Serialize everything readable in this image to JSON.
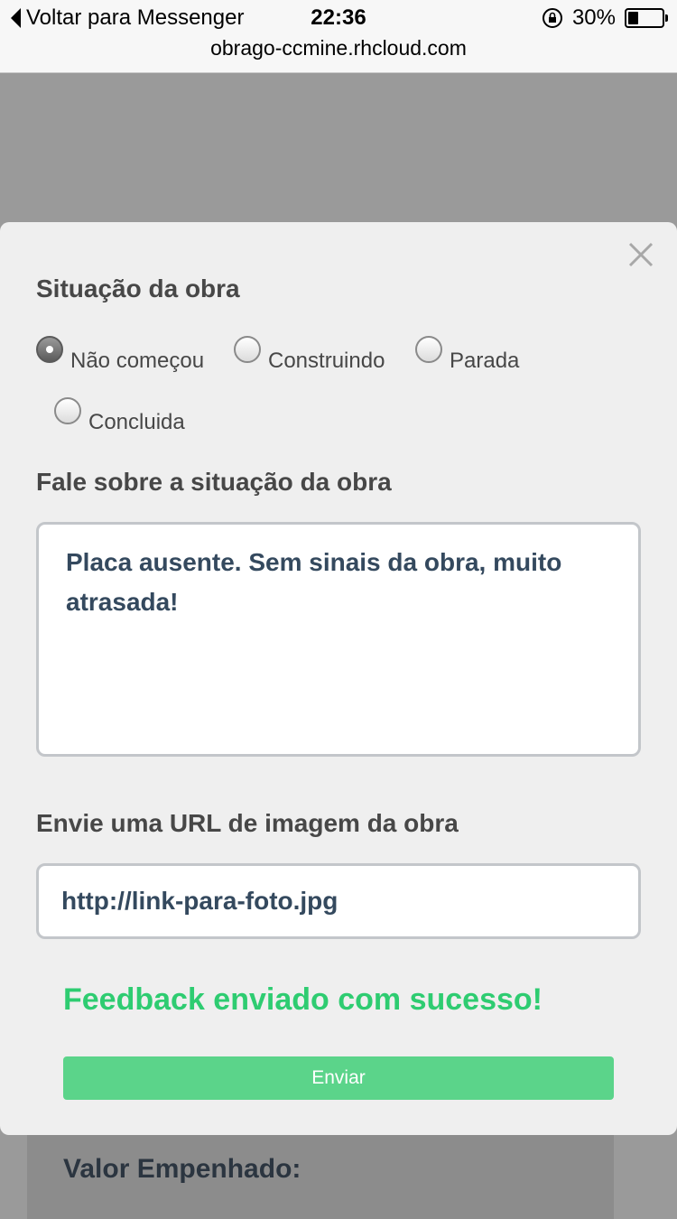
{
  "status_bar": {
    "back_label": "Voltar para Messenger",
    "time": "22:36",
    "battery_percent": "30%",
    "battery_level": 0.3,
    "url": "obrago-ccmine.rhcloud.com"
  },
  "background_page": {
    "label": "Valor Empenhado:"
  },
  "modal": {
    "status_title": "Situação da obra",
    "status_options": [
      {
        "label": "Não começou",
        "selected": true
      },
      {
        "label": "Construindo",
        "selected": false
      },
      {
        "label": "Parada",
        "selected": false
      },
      {
        "label": "Concluida",
        "selected": false
      }
    ],
    "description_title": "Fale sobre a situação da obra",
    "description_value": "Placa ausente. Sem sinais da obra, muito atrasada!",
    "url_title": "Envie uma URL de imagem da obra",
    "url_value": "http://link-para-foto.jpg",
    "feedback_message": "Feedback enviado com sucesso!",
    "submit_label": "Enviar"
  },
  "colors": {
    "accent": "#5bd48a",
    "success_text": "#2ecc71",
    "input_text": "#34495e",
    "overlay": "#9a9a9a"
  }
}
